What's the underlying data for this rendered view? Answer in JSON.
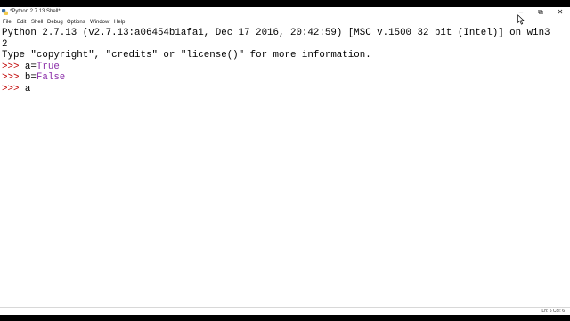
{
  "window": {
    "title": "*Python 2.7.13 Shell*",
    "min_label": "–",
    "restore_label": "⧉",
    "close_label": "✕"
  },
  "menu": [
    "File",
    "Edit",
    "Shell",
    "Debug",
    "Options",
    "Window",
    "Help"
  ],
  "shell": {
    "banner1": "Python 2.7.13 (v2.7.13:a06454b1afa1, Dec 17 2016, 20:42:59) [MSC v.1500 32 bit (Intel)] on win3",
    "banner2": "2",
    "banner3": "Type \"copyright\", \"credits\" or \"license()\" for more information.",
    "prompt": ">>> ",
    "line1_name": "a=",
    "line1_value": "True",
    "line2_name": "b=",
    "line2_value": "False",
    "line3_text": "a"
  },
  "status": {
    "text": "Ln: 5  Col: 6"
  },
  "colors": {
    "prompt": "#c00000",
    "keyword": "#8a2da8"
  }
}
